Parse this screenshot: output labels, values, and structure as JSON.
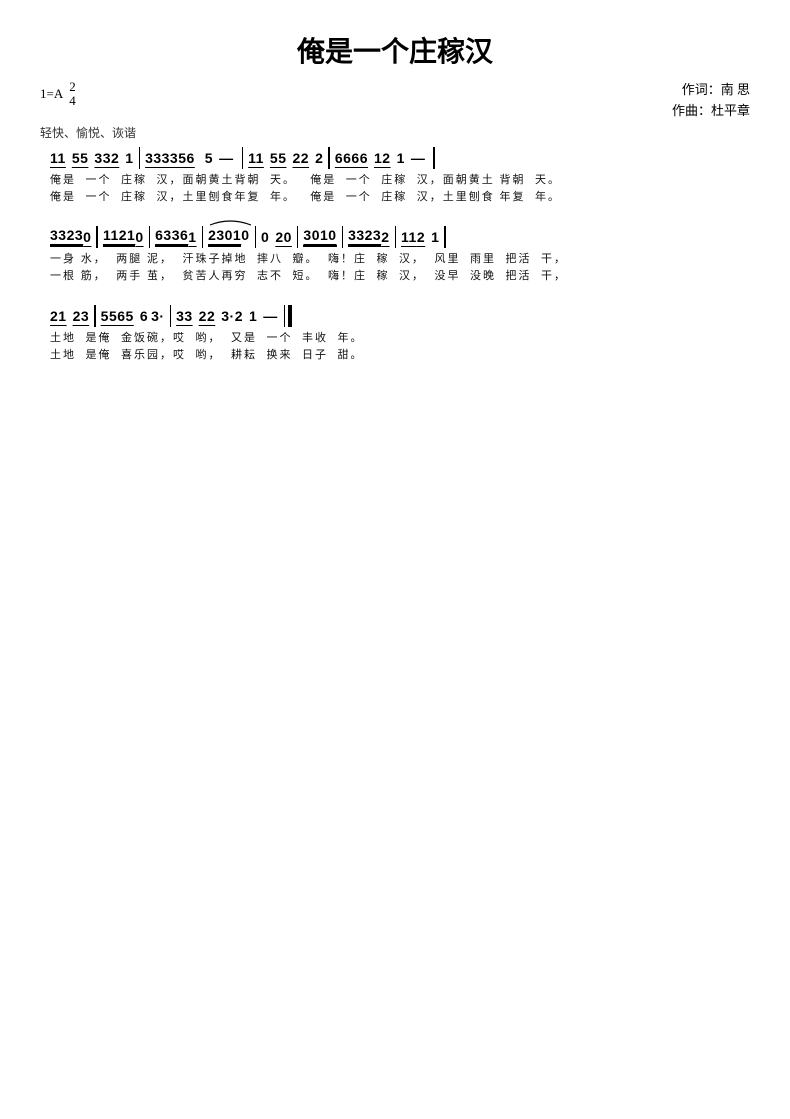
{
  "page": {
    "title": "俺是一个庄稼汉",
    "key": "1=A",
    "time_sig": {
      "top": "2",
      "bottom": "4"
    },
    "tempo": "轻快、愉悦、诙谐",
    "lyricist": "作词：南  思",
    "composer": "作曲：杜平章",
    "rows": [
      {
        "id": "row1",
        "notation": "11  55  332  1  333356  5 —  11  55  22  2  6666  12  1 —",
        "lyrics1": "俺是  一个  庄稼  汉，面朝黄土背朝  天。  俺是  一个  庄稼  汉，面朝黄土 背朝  天。",
        "lyrics2": "俺是  一个  庄稼  汉，土里刨食年复  年。  俺是  一个  庄稼  汉，土里刨食 年复  年。"
      },
      {
        "id": "row2",
        "notation": "33230  11210  63361  23010  0 20  3010  33232  112  1",
        "lyrics1": "一身  水，  两腿  泥，  汗珠子掉地  摔八  瓣。  嗨！庄  稼  汉，  风里  雨里  把活  干，",
        "lyrics2": "一根  筋，  两手  茧，  贫苦人再穷  志不  短。  嗨！庄  稼  汉，  没早  没晚  把活  干，"
      },
      {
        "id": "row3",
        "notation": "21  23  5565  6  3·  33  22  3·2  1 — ‖",
        "lyrics1": "土地  是俺  金饭碗，哎  哟，  又是  一个  丰收  年。",
        "lyrics2": "土地  是俺  喜乐园，哎  哟，  耕耘  换来  日子  甜。"
      }
    ]
  }
}
